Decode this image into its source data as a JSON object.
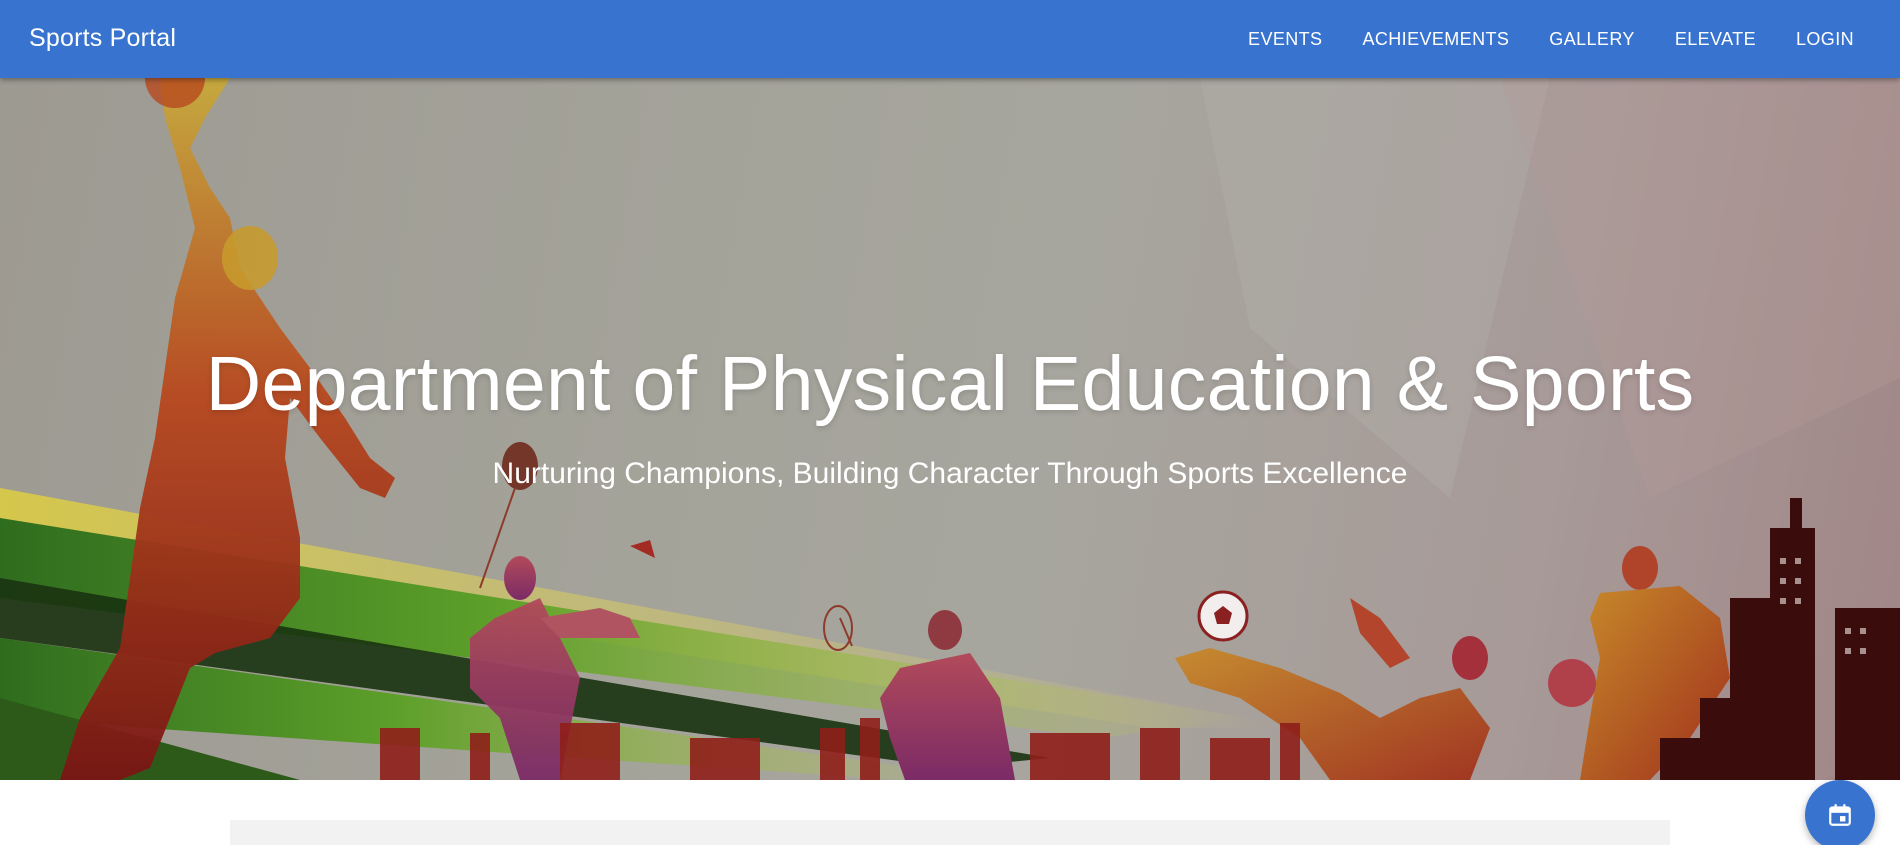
{
  "app": {
    "brand": "Sports Portal"
  },
  "nav": {
    "items": [
      {
        "label": "EVENTS"
      },
      {
        "label": "ACHIEVEMENTS"
      },
      {
        "label": "GALLERY"
      },
      {
        "label": "ELEVATE"
      },
      {
        "label": "LOGIN"
      }
    ]
  },
  "hero": {
    "title": "Department of Physical Education & Sports",
    "subtitle": "Nurturing Champions, Building Character Through Sports Excellence",
    "image_subject": "colorful silhouettes of basketball, badminton, soccer players over a city skyline with green and yellow streaks"
  },
  "fab": {
    "icon": "calendar-icon"
  },
  "colors": {
    "appbar": "#3874cf",
    "hero_overlay": "#a4a39a",
    "white": "#ffffff",
    "panel": "#f2f2f2"
  }
}
